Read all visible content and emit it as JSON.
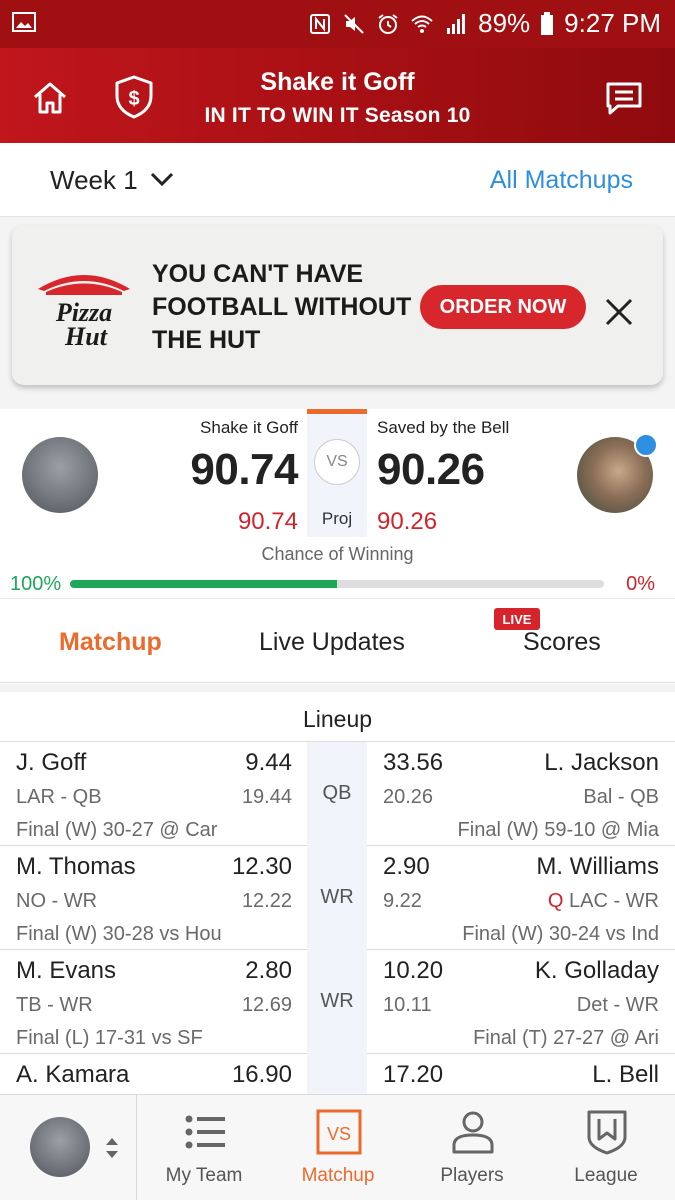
{
  "status_bar": {
    "battery": "89%",
    "time": "9:27 PM"
  },
  "header": {
    "title": "Shake it Goff",
    "subtitle": "IN IT TO WIN IT Season 10"
  },
  "week": {
    "label": "Week 1",
    "all_matchups": "All Matchups"
  },
  "ad": {
    "brand": "Pizza Hut",
    "line1": "YOU CAN'T HAVE",
    "line2": "FOOTBALL WITHOUT",
    "line3": "THE HUT",
    "cta": "ORDER NOW"
  },
  "matchup": {
    "team_left": {
      "name": "Shake it Goff",
      "score": "90.74",
      "proj": "90.74",
      "win_pct": "100%"
    },
    "team_right": {
      "name": "Saved by the Bell",
      "score": "90.26",
      "proj": "90.26",
      "win_pct": "0%"
    },
    "vs_label": "VS",
    "proj_label": "Proj",
    "chance_label": "Chance of Winning",
    "left_win_fraction": 0.5
  },
  "tabs": {
    "matchup": "Matchup",
    "live_updates": "Live Updates",
    "scores": "Scores",
    "live_badge": "LIVE"
  },
  "lineup": {
    "heading": "Lineup",
    "rows": [
      {
        "pos": "QB",
        "left": {
          "name": "J. Goff",
          "pts": "9.44",
          "info": "LAR - QB",
          "proj": "19.44",
          "game": "Final (W) 30-27 @ Car"
        },
        "right": {
          "name": "L. Jackson",
          "pts": "33.56",
          "info": "Bal - QB",
          "proj": "20.26",
          "game": "Final (W) 59-10 @ Mia",
          "flag": ""
        }
      },
      {
        "pos": "WR",
        "left": {
          "name": "M. Thomas",
          "pts": "12.30",
          "info": "NO - WR",
          "proj": "12.22",
          "game": "Final (W) 30-28 vs Hou"
        },
        "right": {
          "name": "M. Williams",
          "pts": "2.90",
          "info": "LAC - WR",
          "proj": "9.22",
          "game": "Final (W) 30-24 vs Ind",
          "flag": "Q"
        }
      },
      {
        "pos": "WR",
        "left": {
          "name": "M. Evans",
          "pts": "2.80",
          "info": "TB - WR",
          "proj": "12.69",
          "game": "Final (L) 17-31 vs SF"
        },
        "right": {
          "name": "K. Golladay",
          "pts": "10.20",
          "info": "Det - WR",
          "proj": "10.11",
          "game": "Final (T) 27-27 @ Ari",
          "flag": ""
        }
      },
      {
        "pos": "",
        "left": {
          "name": "A. Kamara",
          "pts": "16.90",
          "info": "",
          "proj": "",
          "game": ""
        },
        "right": {
          "name": "L. Bell",
          "pts": "17.20",
          "info": "",
          "proj": "",
          "game": "",
          "flag": ""
        }
      }
    ]
  },
  "bottom_nav": {
    "my_team": "My Team",
    "matchup": "Matchup",
    "players": "Players",
    "league": "League",
    "vs_icon_text": "VS"
  },
  "colors": {
    "header_red": "#b01216",
    "accent_orange": "#ec6a2c",
    "link_blue": "#2e8fe0",
    "win_green": "#1fa65a",
    "loss_red": "#d0242c"
  }
}
